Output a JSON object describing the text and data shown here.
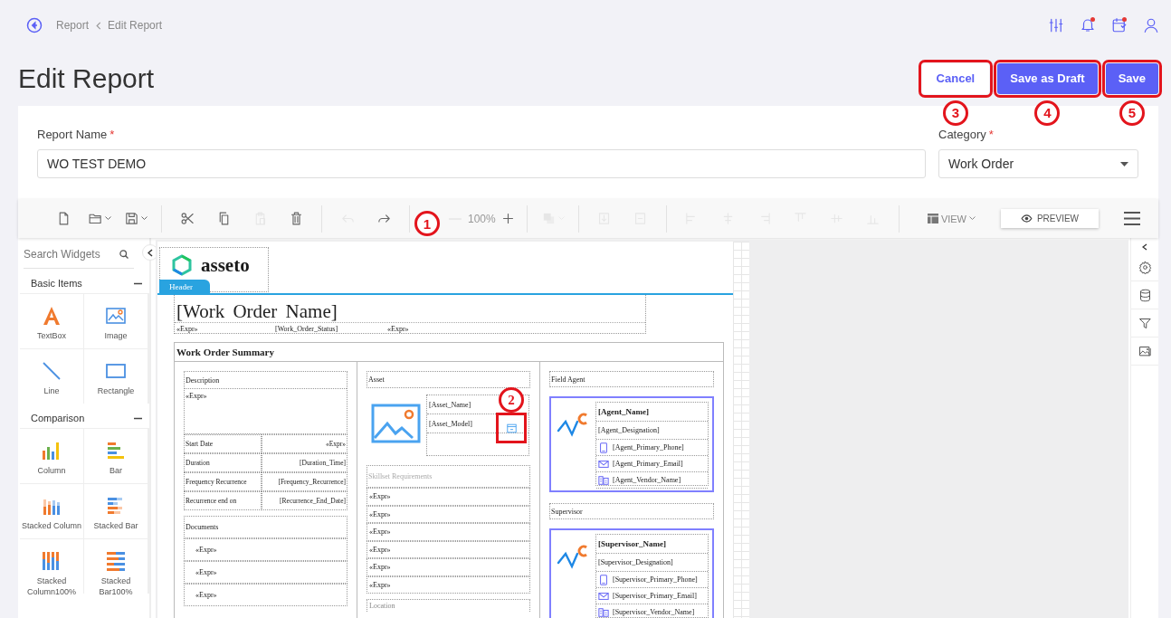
{
  "breadcrumb": [
    "Report",
    "Edit Report"
  ],
  "header_icons": [
    {
      "kind": "sliders",
      "notification": false
    },
    {
      "kind": "bell",
      "notification": true
    },
    {
      "kind": "calendar",
      "notification": true
    },
    {
      "kind": "user",
      "notification": false
    }
  ],
  "title": "Edit Report",
  "actions": [
    {
      "label": "Cancel",
      "kind": "secondary",
      "callout": "3"
    },
    {
      "label": "Save as Draft",
      "kind": "primary",
      "callout": "4"
    },
    {
      "label": "Save",
      "kind": "primary",
      "callout": "5"
    }
  ],
  "form": {
    "fields": [
      {
        "label": "Report Name",
        "required_mark": "*",
        "kind": "text",
        "value": "WO TEST DEMO"
      },
      {
        "label": "Category",
        "required_mark": "*",
        "kind": "select",
        "value": "Work Order"
      }
    ]
  },
  "toolbar": {
    "groups": [
      [
        {
          "kind": "new",
          "disabled": false,
          "dropdown": false
        },
        {
          "kind": "open",
          "disabled": false,
          "dropdown": true
        },
        {
          "kind": "save",
          "disabled": false,
          "dropdown": true
        }
      ],
      [
        {
          "kind": "cut",
          "disabled": false,
          "dropdown": false
        },
        {
          "kind": "copy",
          "disabled": false,
          "dropdown": false
        },
        {
          "kind": "paste",
          "disabled": true,
          "dropdown": false
        },
        {
          "kind": "delete",
          "disabled": false,
          "dropdown": false
        }
      ],
      [
        {
          "kind": "undo",
          "disabled": true,
          "dropdown": false
        },
        {
          "kind": "redo",
          "disabled": false,
          "dropdown": false
        }
      ],
      [
        {
          "kind": "zoom_out",
          "disabled": true,
          "dropdown": false
        },
        {
          "kind": "zoom_level",
          "text": "100%"
        },
        {
          "kind": "zoom_in",
          "disabled": false,
          "dropdown": false
        }
      ],
      [
        {
          "kind": "arrange",
          "disabled": true,
          "dropdown": true
        }
      ],
      [
        {
          "kind": "bring_front",
          "disabled": true,
          "dropdown": false
        },
        {
          "kind": "send_back",
          "disabled": true,
          "dropdown": false
        }
      ],
      [
        {
          "kind": "align_left",
          "disabled": true,
          "dropdown": false
        },
        {
          "kind": "align_center",
          "disabled": true,
          "dropdown": false
        },
        {
          "kind": "align_right",
          "disabled": true,
          "dropdown": false
        },
        {
          "kind": "align_top",
          "disabled": true,
          "dropdown": false
        },
        {
          "kind": "align_middle",
          "disabled": true,
          "dropdown": false
        },
        {
          "kind": "align_bottom",
          "disabled": true,
          "dropdown": false
        }
      ]
    ],
    "view_label": "VIEW",
    "preview_label": "PREVIEW"
  },
  "widgets": {
    "search_placeholder": "Search Widgets",
    "groups": [
      {
        "title": "Basic Items",
        "expanded": true,
        "items": [
          {
            "kind": "textbox",
            "label": "TextBox"
          },
          {
            "kind": "image",
            "label": "Image"
          },
          {
            "kind": "line",
            "label": "Line"
          },
          {
            "kind": "rectangle",
            "label": "Rectangle"
          }
        ]
      },
      {
        "title": "Comparison",
        "expanded": true,
        "items": [
          {
            "kind": "column",
            "label": "Column"
          },
          {
            "kind": "bar",
            "label": "Bar"
          },
          {
            "kind": "stacked_column",
            "label": "Stacked Column"
          },
          {
            "kind": "stacked_bar",
            "label": "Stacked Bar"
          },
          {
            "kind": "stacked_column100",
            "label": "Stacked Column100%"
          },
          {
            "kind": "stacked_bar100",
            "label": "Stacked Bar100%"
          }
        ]
      }
    ]
  },
  "canvas": {
    "callout": "1"
  },
  "report": {
    "logo_text": "asseto",
    "band_label": "Header",
    "title": "[Work Order Name]",
    "title_fields": [
      "«Expr»",
      "[Work_Order_Status]",
      "«Expr»"
    ],
    "summary_heading": "Work Order Summary",
    "description": {
      "label": "Description",
      "value": "«Expr»"
    },
    "details": [
      {
        "label": "Start Date",
        "value": "«Expr»"
      },
      {
        "label": "Duration",
        "value": "[Duration_Time]"
      },
      {
        "label": "Frequency Recurrence",
        "value": "[Frequency_Recurrence]"
      },
      {
        "label": "Recurrence end on",
        "value": "[Recurrence_End_Date]"
      }
    ],
    "documents": {
      "label": "Documents",
      "rows": [
        "«Expr»",
        "«Expr»",
        "«Expr»"
      ]
    },
    "asset": {
      "label": "Asset",
      "fields": [
        "[Asset_Name]",
        "[Asset_Model]"
      ],
      "callout": "2"
    },
    "skillset": {
      "label": "Skillset Requirements",
      "rows": [
        "«Expr»",
        "«Expr»",
        "«Expr»",
        "«Expr»",
        "«Expr»",
        "«Expr»"
      ]
    },
    "location": {
      "label": "Location"
    },
    "people": [
      {
        "label": "Field Agent",
        "name": "[Agent_Name]",
        "designation": "[Agent_Designation]",
        "contacts": [
          {
            "kind": "phone",
            "text": "[Agent_Primary_Phone]"
          },
          {
            "kind": "email",
            "text": "[Agent_Primary_Email]"
          },
          {
            "kind": "vendor",
            "text": "[Agent_Vendor_Name]"
          }
        ]
      },
      {
        "label": "Supervisor",
        "name": "[Supervisor_Name]",
        "designation": "[Supervisor_Designation]",
        "contacts": [
          {
            "kind": "phone",
            "text": "[Supervisor_Primary_Phone]"
          },
          {
            "kind": "email",
            "text": "[Supervisor_Primary_Email]"
          },
          {
            "kind": "vendor",
            "text": "[Supervisor_Vendor_Name]"
          }
        ]
      }
    ]
  },
  "right_rail": [
    {
      "kind": "collapse"
    },
    {
      "kind": "settings"
    },
    {
      "kind": "data"
    },
    {
      "kind": "filter"
    },
    {
      "kind": "image"
    }
  ]
}
